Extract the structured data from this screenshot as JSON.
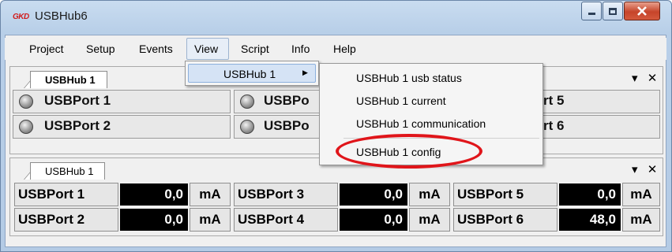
{
  "window": {
    "logo": "GKD",
    "title": "USBHub6"
  },
  "menu": [
    "Project",
    "Setup",
    "Events",
    "View",
    "Script",
    "Info",
    "Help"
  ],
  "view_menu": {
    "item": "USBHub 1",
    "arrow": "▶"
  },
  "submenu": [
    "USBHub 1 usb status",
    "USBHub 1 current",
    "USBHub 1 communication",
    "USBHub 1 config"
  ],
  "panel1": {
    "tab": "USBHub 1",
    "controls": "▾ ✕",
    "ports": [
      {
        "label": "USBPort 1"
      },
      {
        "label": "USBPort 2"
      },
      {
        "label": "USBPo"
      },
      {
        "label": "USBPo"
      },
      {
        "label": "rt 5"
      },
      {
        "label": "rt 6"
      }
    ]
  },
  "panel2": {
    "tab": "USBHub 1",
    "controls": "▾ ✕",
    "ports": [
      {
        "label": "USBPort 1",
        "value": "0,0",
        "unit": "mA"
      },
      {
        "label": "USBPort 2",
        "value": "0,0",
        "unit": "mA"
      },
      {
        "label": "USBPort 3",
        "value": "0,0",
        "unit": "mA"
      },
      {
        "label": "USBPort 4",
        "value": "0,0",
        "unit": "mA"
      },
      {
        "label": "USBPort 5",
        "value": "0,0",
        "unit": "mA"
      },
      {
        "label": "USBPort 6",
        "value": "48,0",
        "unit": "mA"
      }
    ]
  },
  "colors": {
    "highlight_oval": "#e0151a",
    "logo": "#d11c1c"
  }
}
